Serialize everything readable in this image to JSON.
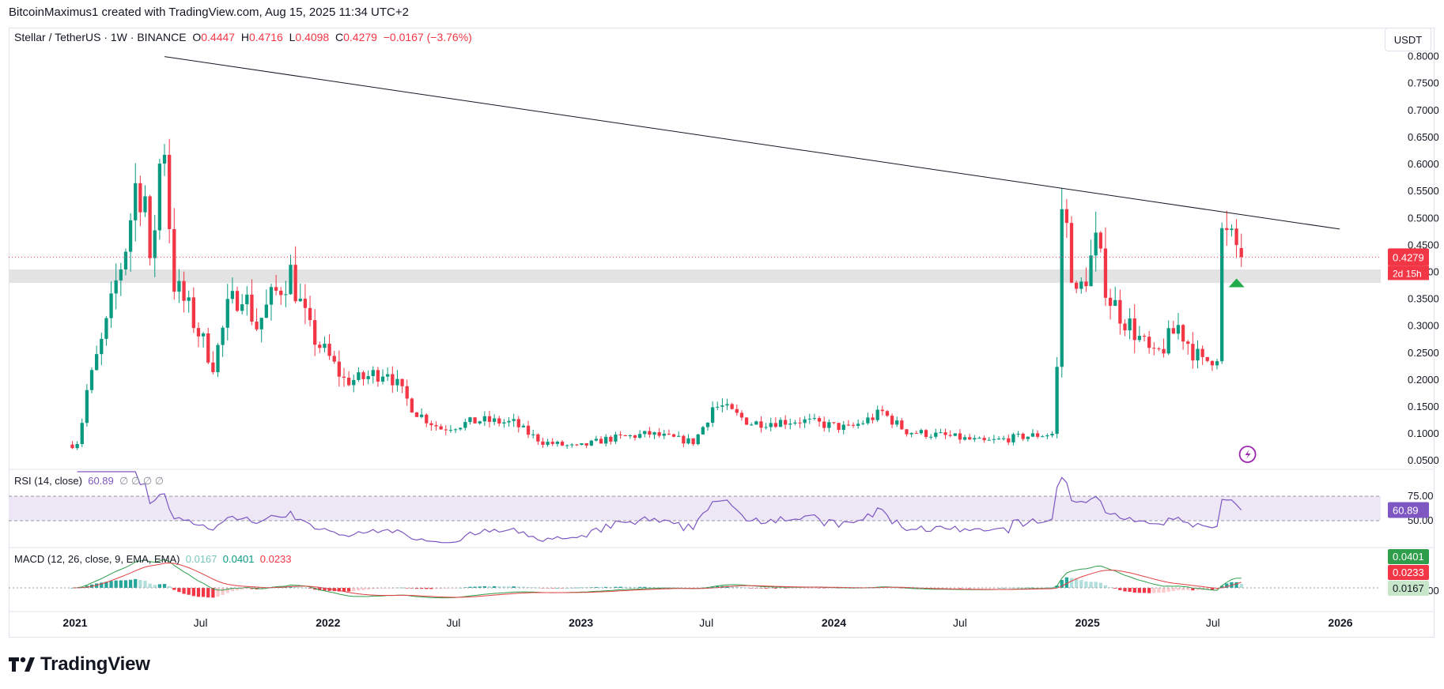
{
  "header": {
    "text": "BitcoinMaximus1 created with TradingView.com, Aug 15, 2025 11:34 UTC+2"
  },
  "legend": {
    "symbol": "Stellar / TetherUS · 1W · BINANCE",
    "o_label": "O",
    "o_value": "0.4447",
    "h_label": "H",
    "h_value": "0.4716",
    "l_label": "L",
    "l_value": "0.4098",
    "c_label": "C",
    "c_value": "0.4279",
    "change": "−0.0167 (−3.76%)"
  },
  "currency": "USDT",
  "price_badge": {
    "price": "0.4279",
    "countdown": "2d 15h"
  },
  "rsi": {
    "label": "RSI (14, close)",
    "value": "60.89",
    "extras": "∅ ∅ ∅ ∅",
    "badge": "60.89",
    "upper": "75.00",
    "lower": "50.00"
  },
  "macd": {
    "label": "MACD (12, 26, close, 9, EMA, EMA)",
    "v1": "0.0167",
    "v2": "0.0401",
    "v3": "0.0233",
    "badge_macd": "0.0401",
    "badge_signal": "0.0233",
    "badge_hist": "0.0167",
    "zero_label": "0.0000"
  },
  "brand": {
    "name": "TradingView"
  },
  "colors": {
    "up": "#089981",
    "down": "#f23645",
    "rsi_line": "#7e57c2",
    "rsi_band": "#ede7f6",
    "macd_line": "#2e9e4a",
    "signal_line": "#e04040",
    "support_zone": "#e3e3e3"
  },
  "icons": {
    "brand_logo": "tradingview-logo-icon",
    "flash": "lightning-icon",
    "marker": "triangle-up-icon"
  },
  "chart_data": {
    "type": "candlestick",
    "timeframe": "1W",
    "y_axis": {
      "ticks": [
        "0.0500",
        "0.1000",
        "0.1500",
        "0.2000",
        "0.2500",
        "0.3000",
        "0.3500",
        "0.4000",
        "0.4500",
        "0.5000",
        "0.5500",
        "0.6000",
        "0.6500",
        "0.7000",
        "0.7500",
        "0.8000"
      ],
      "range": [
        0.04,
        0.82
      ]
    },
    "x_axis": {
      "labels": [
        "2021",
        "Jul",
        "2022",
        "Jul",
        "2023",
        "Jul",
        "2024",
        "Jul",
        "2025",
        "Jul",
        "2026"
      ]
    },
    "support_zone": [
      0.38,
      0.405
    ],
    "trendline": {
      "from": {
        "date": "2021-05-10",
        "price": 0.8
      },
      "to": {
        "date": "2025-12-31",
        "price": 0.48
      }
    },
    "current_price": 0.4279,
    "close_path": [
      [
        "2020-12-28",
        0.08
      ],
      [
        "2021-01-04",
        0.085
      ],
      [
        "2021-01-18",
        0.18
      ],
      [
        "2021-02-01",
        0.24
      ],
      [
        "2021-02-15",
        0.3
      ],
      [
        "2021-03-01",
        0.38
      ],
      [
        "2021-03-15",
        0.45
      ],
      [
        "2021-03-29",
        0.56
      ],
      [
        "2021-04-12",
        0.54
      ],
      [
        "2021-04-19",
        0.4
      ],
      [
        "2021-05-03",
        0.6
      ],
      [
        "2021-05-10",
        0.64
      ],
      [
        "2021-05-24",
        0.38
      ],
      [
        "2021-06-14",
        0.33
      ],
      [
        "2021-07-05",
        0.27
      ],
      [
        "2021-07-19",
        0.23
      ],
      [
        "2021-08-09",
        0.33
      ],
      [
        "2021-08-30",
        0.37
      ],
      [
        "2021-09-20",
        0.3
      ],
      [
        "2021-10-11",
        0.35
      ],
      [
        "2021-11-08",
        0.4
      ],
      [
        "2021-12-06",
        0.29
      ],
      [
        "2022-01-03",
        0.24
      ],
      [
        "2022-01-24",
        0.2
      ],
      [
        "2022-02-14",
        0.2
      ],
      [
        "2022-03-28",
        0.22
      ],
      [
        "2022-05-09",
        0.14
      ],
      [
        "2022-06-13",
        0.11
      ],
      [
        "2022-08-08",
        0.125
      ],
      [
        "2022-09-26",
        0.12
      ],
      [
        "2022-11-07",
        0.085
      ],
      [
        "2022-12-26",
        0.075
      ],
      [
        "2023-02-06",
        0.09
      ],
      [
        "2023-04-10",
        0.1
      ],
      [
        "2023-06-12",
        0.085
      ],
      [
        "2023-07-10",
        0.15
      ],
      [
        "2023-07-24",
        0.15
      ],
      [
        "2023-09-04",
        0.12
      ],
      [
        "2023-11-13",
        0.125
      ],
      [
        "2024-01-22",
        0.11
      ],
      [
        "2024-03-11",
        0.14
      ],
      [
        "2024-04-15",
        0.105
      ],
      [
        "2024-06-17",
        0.095
      ],
      [
        "2024-08-05",
        0.085
      ],
      [
        "2024-09-30",
        0.095
      ],
      [
        "2024-11-11",
        0.1
      ],
      [
        "2024-11-18",
        0.22
      ],
      [
        "2024-11-25",
        0.52
      ],
      [
        "2024-12-02",
        0.48
      ],
      [
        "2024-12-16",
        0.35
      ],
      [
        "2025-01-13",
        0.45
      ],
      [
        "2025-02-03",
        0.35
      ],
      [
        "2025-03-10",
        0.29
      ],
      [
        "2025-04-07",
        0.24
      ],
      [
        "2025-05-12",
        0.3
      ],
      [
        "2025-06-16",
        0.23
      ],
      [
        "2025-07-07",
        0.25
      ],
      [
        "2025-07-14",
        0.47
      ],
      [
        "2025-08-04",
        0.447
      ],
      [
        "2025-08-11",
        0.4279
      ]
    ],
    "rsi_series": {
      "range": [
        25,
        100
      ],
      "guides": [
        75,
        50
      ],
      "last": 60.89
    },
    "macd_series": {
      "last_macd": 0.0401,
      "last_signal": 0.0233,
      "last_hist": 0.0167
    }
  }
}
